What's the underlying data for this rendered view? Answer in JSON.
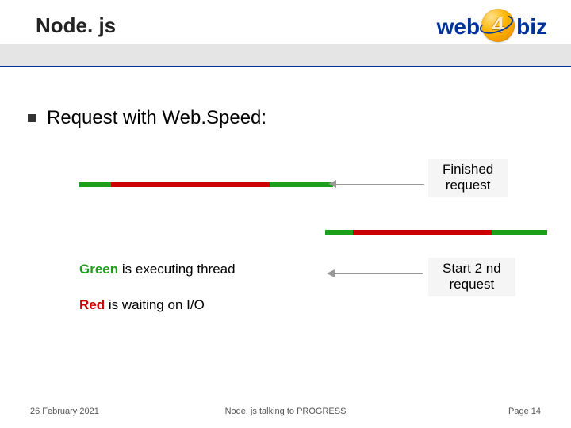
{
  "title": "Node. js",
  "logo": {
    "left": "web",
    "num": "4",
    "right": "biz"
  },
  "bullet": "Request with Web.Speed:",
  "labels": {
    "finished": "Finished\nrequest",
    "start2nd": "Start 2 nd\nrequest"
  },
  "legend": {
    "green_word": "Green",
    "green_rest": " is executing thread",
    "red_word": "Red",
    "red_rest": " is waiting on I/O"
  },
  "footer": {
    "date": "26 February 2021",
    "center": "Node. js talking to PROGRESS",
    "page": "Page 14"
  }
}
